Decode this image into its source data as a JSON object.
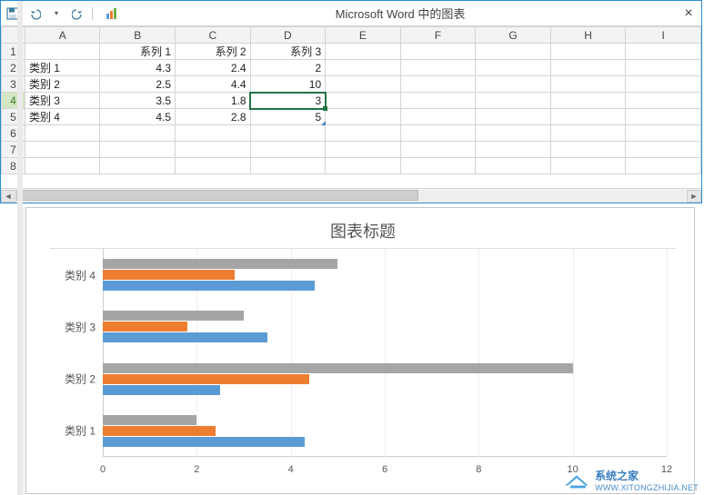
{
  "window": {
    "title": "Microsoft Word 中的图表",
    "qat": {
      "save": "保存",
      "undo": "撤销",
      "redo": "重做",
      "chart": "图表"
    }
  },
  "spreadsheet": {
    "columns": [
      "A",
      "B",
      "C",
      "D",
      "E",
      "F",
      "G",
      "H",
      "I"
    ],
    "row_numbers": [
      "1",
      "2",
      "3",
      "4",
      "5",
      "6",
      "7",
      "8"
    ],
    "header_row": [
      "",
      "系列 1",
      "系列 2",
      "系列 3"
    ],
    "rows": [
      {
        "label": "类别 1",
        "vals": [
          "4.3",
          "2.4",
          "2"
        ]
      },
      {
        "label": "类别 2",
        "vals": [
          "2.5",
          "4.4",
          "10"
        ]
      },
      {
        "label": "类别 3",
        "vals": [
          "3.5",
          "1.8",
          "3"
        ]
      },
      {
        "label": "类别 4",
        "vals": [
          "4.5",
          "2.8",
          "5"
        ]
      }
    ],
    "selected_cell": {
      "row": 4,
      "col": "D"
    }
  },
  "chart_data": {
    "type": "bar",
    "title": "图表标题",
    "categories": [
      "类别 4",
      "类别 3",
      "类别 2",
      "类别 1"
    ],
    "series": [
      {
        "name": "系列 3",
        "values": [
          5,
          3,
          10,
          2
        ],
        "color": "#a5a5a5"
      },
      {
        "name": "系列 2",
        "values": [
          2.8,
          1.8,
          4.4,
          2.4
        ],
        "color": "#ed7d31"
      },
      {
        "name": "系列 1",
        "values": [
          4.5,
          3.5,
          2.5,
          4.3
        ],
        "color": "#5b9bd5"
      }
    ],
    "xlabel": "",
    "ylabel": "",
    "xlim": [
      0,
      12
    ],
    "xticks": [
      0,
      2,
      4,
      6,
      8,
      10,
      12
    ]
  },
  "chart_axis_ticks": {
    "t0": "0",
    "t1": "2",
    "t2": "4",
    "t3": "6",
    "t4": "8",
    "t5": "10",
    "t6": "12"
  },
  "chart_cat_labels": {
    "c0": "类别 4",
    "c1": "类别 3",
    "c2": "类别 2",
    "c3": "类别 1"
  },
  "watermark": {
    "cn": "系统之家",
    "url": "WWW.XITONGZHIJIA.NET"
  }
}
